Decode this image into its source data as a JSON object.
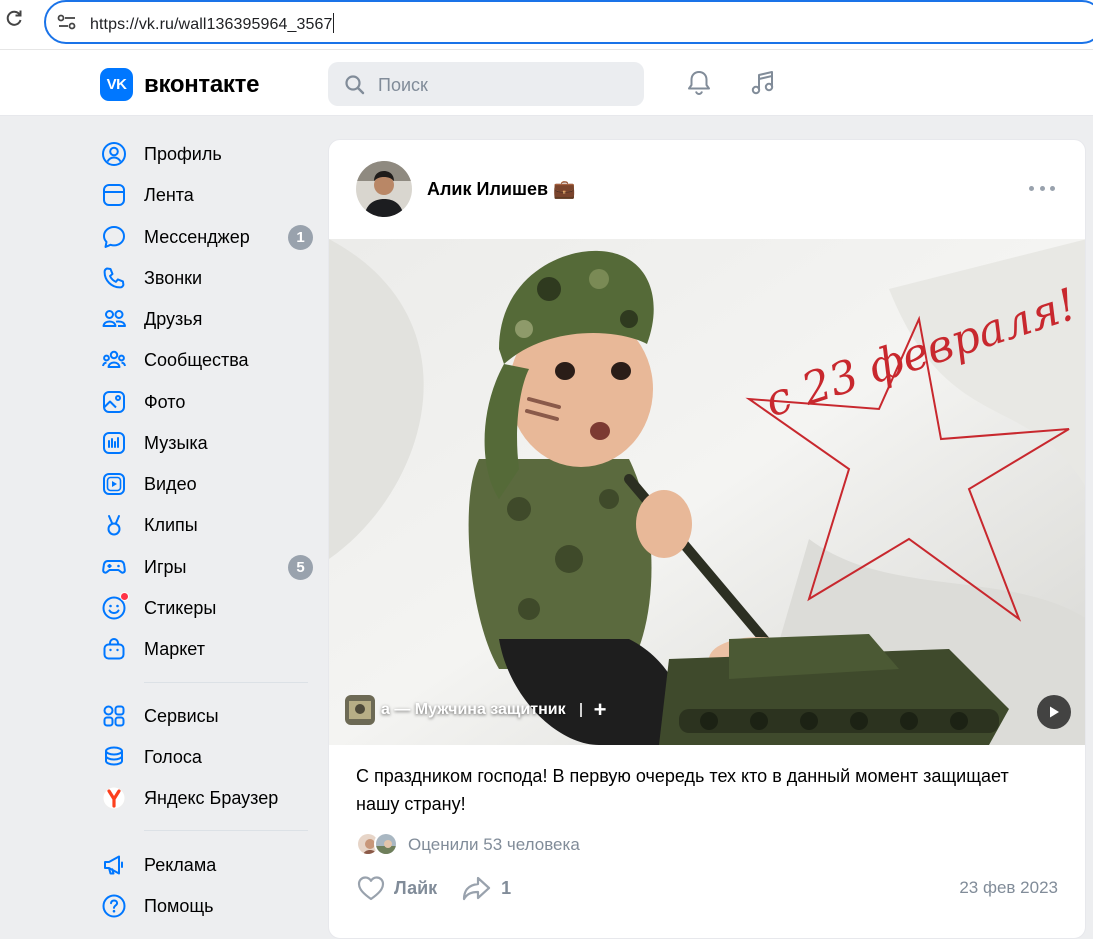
{
  "browser": {
    "url": "https://vk.ru/wall136395964_3567"
  },
  "header": {
    "logo_text": "вконтакте",
    "logo_badge": "VK",
    "search_placeholder": "Поиск"
  },
  "sidebar": {
    "items": [
      {
        "label": "Профиль",
        "icon": "profile-icon"
      },
      {
        "label": "Лента",
        "icon": "feed-icon"
      },
      {
        "label": "Мессенджер",
        "icon": "messenger-icon",
        "badge": "1"
      },
      {
        "label": "Звонки",
        "icon": "phone-icon"
      },
      {
        "label": "Друзья",
        "icon": "friends-icon"
      },
      {
        "label": "Сообщества",
        "icon": "communities-icon"
      },
      {
        "label": "Фото",
        "icon": "photo-icon"
      },
      {
        "label": "Музыка",
        "icon": "music-icon"
      },
      {
        "label": "Видео",
        "icon": "video-icon"
      },
      {
        "label": "Клипы",
        "icon": "clips-icon"
      },
      {
        "label": "Игры",
        "icon": "games-icon",
        "badge": "5"
      },
      {
        "label": "Стикеры",
        "icon": "stickers-icon"
      },
      {
        "label": "Маркет",
        "icon": "market-icon"
      }
    ],
    "services": [
      {
        "label": "Сервисы",
        "icon": "services-icon"
      },
      {
        "label": "Голоса",
        "icon": "votes-icon"
      },
      {
        "label": "Яндекс Браузер",
        "icon": "yandex-icon"
      }
    ],
    "bottom": [
      {
        "label": "Реклама",
        "icon": "ads-icon"
      },
      {
        "label": "Помощь",
        "icon": "help-icon"
      }
    ]
  },
  "post": {
    "author": "Алик Илишев 💼",
    "audio_title": "а — Мужчина защитник",
    "image_caption": "с 23 февраля!",
    "text": "С праздником господа! В первую очередь тех кто в данный момент защищает нашу страну!",
    "likes_prefix": "Оценили",
    "likes_count": "53 человека",
    "like_label": "Лайк",
    "share_count": "1",
    "date": "23 фев 2023"
  },
  "colors": {
    "accent": "#0077ff",
    "muted": "#818c99",
    "badge": "#99a2ad"
  }
}
